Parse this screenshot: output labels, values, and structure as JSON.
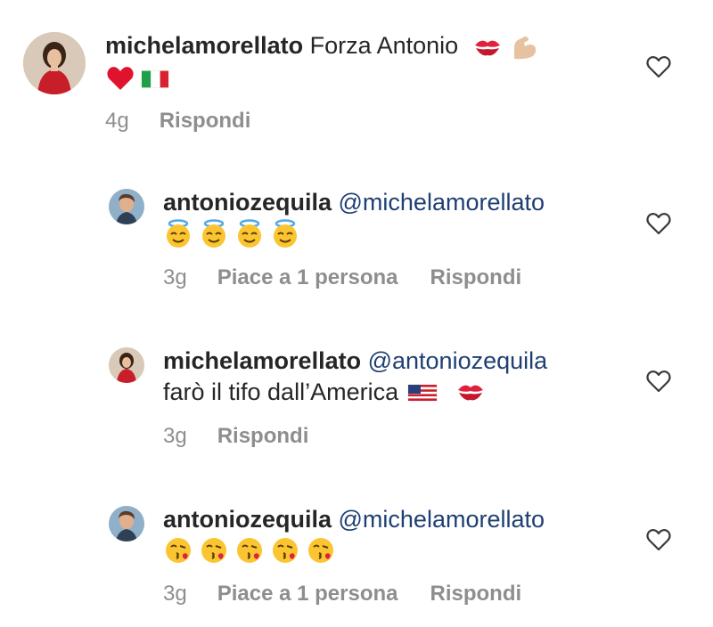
{
  "comments": [
    {
      "username": "michelamorellato",
      "mention": "",
      "text": "Forza Antonio",
      "second_line_text": "",
      "emojis_line1": [
        "kiss-mark",
        "flexed-biceps"
      ],
      "emojis_line2": [
        "red-heart",
        "italy-flag"
      ],
      "time": "4g",
      "likes": "",
      "reply": "Rispondi"
    },
    {
      "username": "antoniozequila",
      "mention": "@michelamorellato",
      "text": "",
      "second_line_text": "",
      "emojis_line2": [
        "halo-face",
        "halo-face",
        "halo-face",
        "halo-face"
      ],
      "time": "3g",
      "likes": "Piace a 1 persona",
      "reply": "Rispondi"
    },
    {
      "username": "michelamorellato",
      "mention": "@antoniozequila",
      "text": "",
      "second_line_text": "farò il tifo dall’America",
      "emojis_line2": [
        "us-flag",
        "kiss-mark"
      ],
      "time": "3g",
      "likes": "",
      "reply": "Rispondi"
    },
    {
      "username": "antoniozequila",
      "mention": "@michelamorellato",
      "text": "",
      "second_line_text": "",
      "emojis_line2": [
        "kissing-face",
        "kissing-face",
        "kissing-face",
        "kissing-face",
        "kissing-face"
      ],
      "time": "3g",
      "likes": "Piace a 1 persona",
      "reply": "Rispondi"
    }
  ],
  "colors": {
    "username": "#262626",
    "mention": "#1f3f73",
    "meta": "#8e8e8e"
  }
}
